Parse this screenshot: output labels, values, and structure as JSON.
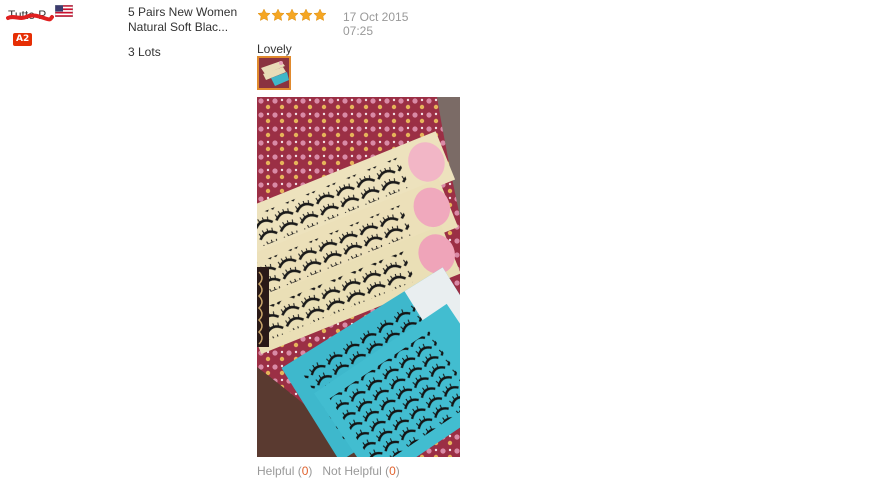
{
  "buyer": {
    "name": "Tutte P.",
    "level_badge": "A2",
    "country_flag_icon": "us-flag-icon"
  },
  "product": {
    "title_line1": "5 Pairs New Women",
    "title_line2": "Natural Soft Blac...",
    "quantity": "3 Lots"
  },
  "feedback": {
    "rating": 5,
    "max_rating": 5,
    "date_line1": "17 Oct 2015",
    "date_line2": "07:25",
    "text": "Lovely",
    "helpful_label": "Helpful (",
    "helpful_count": "0",
    "helpful_close": ")",
    "not_helpful_label": "Not Helpful (",
    "not_helpful_count": "0",
    "not_helpful_close": ")"
  },
  "colors": {
    "star": "#f5a623",
    "badge": "#e62e04",
    "count": "#e0622e",
    "thumb_border": "#e08a2e"
  }
}
